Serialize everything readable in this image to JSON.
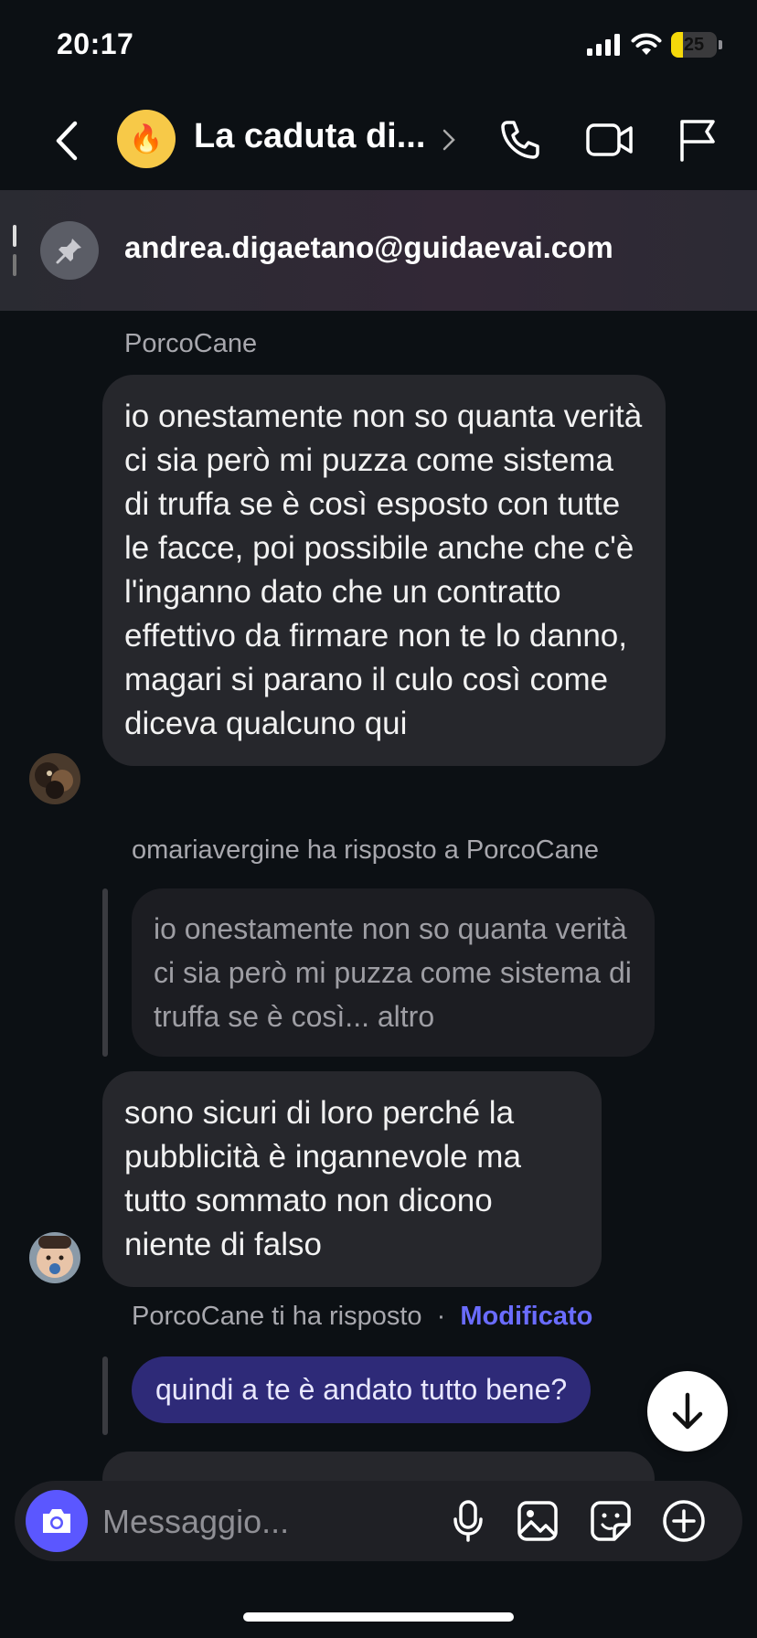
{
  "status_bar": {
    "time": "20:17",
    "battery_level": "25",
    "battery_fraction": 0.25
  },
  "header": {
    "group_emoji": "🔥",
    "title": "La caduta di...",
    "icons": [
      "back-icon",
      "phone-icon",
      "video-icon",
      "flag-icon"
    ]
  },
  "pinned": {
    "text": "andrea.digaetano@guidaevai.com"
  },
  "messages": [
    {
      "sender": "PorcoCane",
      "text": "io onestamente non so quanta verità ci sia però mi puzza come sistema di truffa se è così esposto con tutte le facce, poi possibile anche che c'è l'inganno dato che un contratto effettivo da firmare non te lo danno, magari si parano il culo così come diceva qualcuno qui"
    },
    {
      "reply_info": "omariavergine ha risposto a PorcoCane",
      "quote": "io onestamente non so quanta verità ci sia però mi puzza come sistema di truffa se è così... altro",
      "text": "sono sicuri di loro perché la pubblicità è ingannevole ma tutto sommato non dicono niente di falso"
    },
    {
      "reply_info": "PorcoCane ti ha risposto",
      "separator": "·",
      "edited_label": "Modificato",
      "quote": "quindi a te è andato tutto bene?"
    }
  ],
  "composer": {
    "placeholder": "Messaggio...",
    "icons": [
      "camera-icon",
      "microphone-icon",
      "gallery-icon",
      "sticker-icon",
      "plus-icon"
    ]
  },
  "colors": {
    "background": "#0c1014",
    "bubble": "#26272c",
    "own_bubble": "#2e2a78",
    "accent": "#5b57ff",
    "edited": "#6a6cff"
  }
}
